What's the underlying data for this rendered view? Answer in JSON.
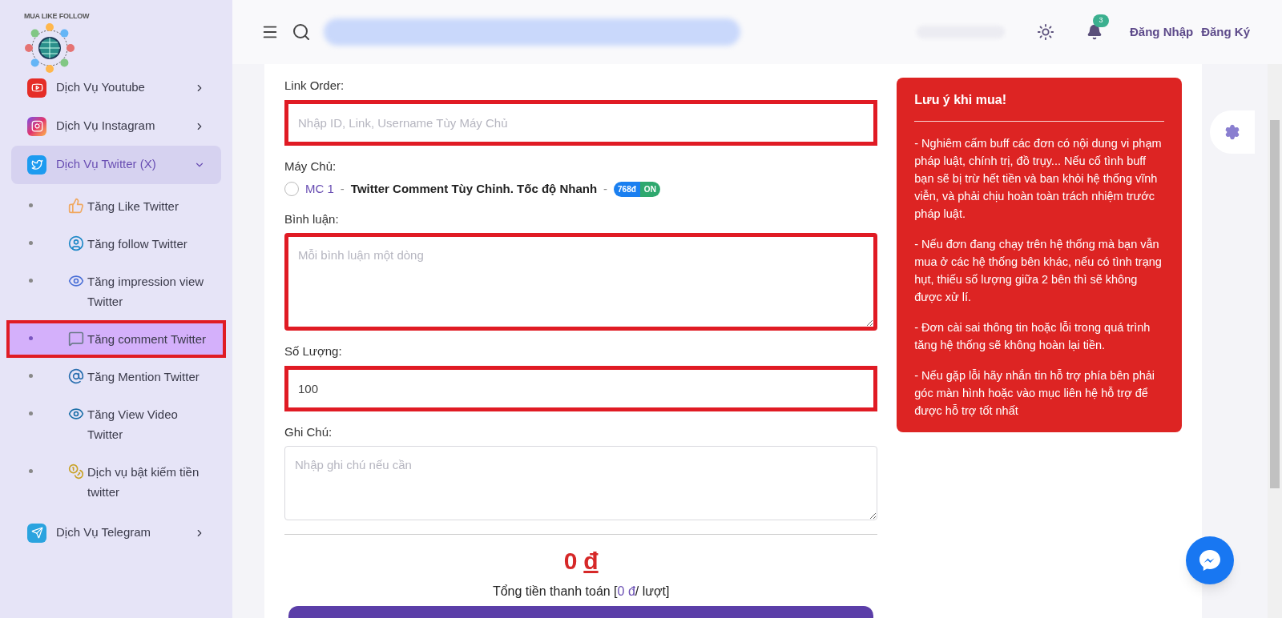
{
  "brand": {
    "name": "MUA LIKE FOLLOW"
  },
  "sidebar": {
    "items": [
      {
        "label": "Dịch Vụ Youtube",
        "kind": "youtube",
        "expanded": false
      },
      {
        "label": "Dịch Vụ Instagram",
        "kind": "instagram",
        "expanded": false
      },
      {
        "label": "Dịch Vụ Twitter (X)",
        "kind": "twitter",
        "expanded": true,
        "children": [
          {
            "label": "Tăng Like Twitter",
            "selected": false,
            "highlighted": false
          },
          {
            "label": "Tăng follow Twitter",
            "selected": false,
            "highlighted": false
          },
          {
            "label": "Tăng impression view Twitter",
            "selected": false,
            "highlighted": false
          },
          {
            "label": "Tăng comment Twitter",
            "selected": true,
            "highlighted": true
          },
          {
            "label": "Tăng Mention Twitter",
            "selected": false,
            "highlighted": false
          },
          {
            "label": "Tăng View Video Twitter",
            "selected": false,
            "highlighted": false
          },
          {
            "label": "Dịch vụ bật kiếm tiền twitter",
            "selected": false,
            "highlighted": false
          }
        ]
      },
      {
        "label": "Dịch Vụ Telegram",
        "kind": "telegram",
        "expanded": false
      }
    ]
  },
  "header": {
    "notifications": "3",
    "links": [
      "Đăng Nhập",
      "Đăng Ký"
    ]
  },
  "form": {
    "fields": [
      {
        "kind": "input",
        "label": "Link Order:",
        "placeholder": "Nhập ID, Link, Username Tùy Máy Chủ",
        "highlighted": true
      },
      {
        "kind": "radio",
        "label": "Máy Chủ:",
        "options": [
          {
            "code": "MC 1",
            "separators": [
              "-",
              "-"
            ],
            "name": "Twitter Comment Tùy Chỉnh. Tốc độ Nhanh",
            "price": "768đ",
            "status": "ON",
            "selected": false
          }
        ]
      },
      {
        "kind": "textarea",
        "label": "Bình luận:",
        "placeholder": "Mỗi bình luận một dòng",
        "highlighted": true
      },
      {
        "kind": "input",
        "label": "Số Lượng:",
        "value": "100",
        "highlighted": true
      },
      {
        "kind": "textarea",
        "label": "Ghi Chú:",
        "placeholder": "Nhập ghi chú nếu cần",
        "highlighted": false
      }
    ]
  },
  "total": {
    "amount": "0",
    "currency": "đ",
    "label": "Tổng tiền thanh toán [",
    "unit_price": "0 đ",
    "suffix": "/ lượt]"
  },
  "notice": {
    "title": "Lưu ý khi mua!",
    "paragraphs": [
      "- Nghiêm cấm buff các đơn có nội dung vi phạm pháp luật, chính trị, đồ trụy... Nếu cố tình buff bạn sẽ bị trừ hết tiền và ban khỏi hệ thống vĩnh viễn, và phải chịu hoàn toàn trách nhiệm trước pháp luật.",
      "- Nếu đơn đang chạy trên hệ thống mà bạn vẫn mua ở các hệ thống bên khác, nếu có tình trạng hụt, thiếu số lượng giữa 2 bên thì sẽ không được xử lí.",
      "- Đơn cài sai thông tin hoặc lỗi trong quá trình tăng hệ thống sẽ không hoàn lại tiền.",
      "- Nếu gặp lỗi hãy nhắn tin hỗ trợ phía bên phải góc màn hình hoặc vào mục liên hệ hỗ trợ để được hỗ trợ tốt nhất"
    ]
  }
}
